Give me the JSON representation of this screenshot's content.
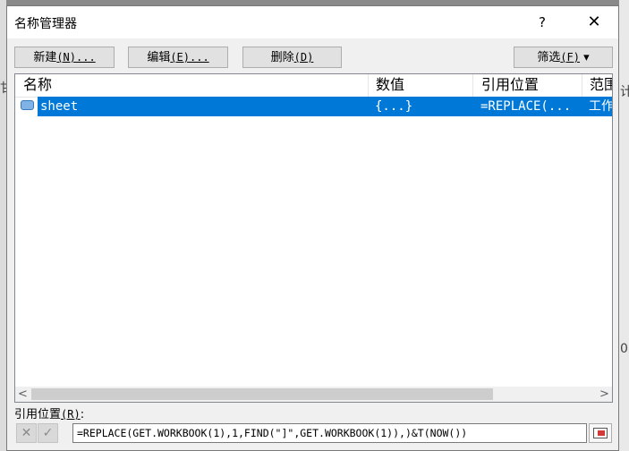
{
  "dialog": {
    "title": "名称管理器",
    "help": "?",
    "close": "✕"
  },
  "toolbar": {
    "new_label": "新建",
    "new_key": "(N)...",
    "edit_label": "编辑",
    "edit_key": "(E)...",
    "delete_label": "删除",
    "delete_key": "(D)",
    "filter_label": "筛选",
    "filter_key": "(F)",
    "filter_arrow": "▾"
  },
  "columns": [
    "名称",
    "数值",
    "引用位置",
    "范围"
  ],
  "rows": [
    {
      "name": "sheet",
      "value": "{...}",
      "refers_to": "=REPLACE(...",
      "scope": "工作簿"
    }
  ],
  "scroll": {
    "left": "<",
    "right": ">"
  },
  "reference": {
    "label": "引用位置",
    "key": "(R)",
    "colon": ":",
    "value": "=REPLACE(GET.WORKBOOK(1),1,FIND(\"]\",GET.WORKBOOK(1)),)&T(NOW())",
    "cancel_glyph": "✕",
    "confirm_glyph": "✓"
  },
  "background": {
    "right_char": "计",
    "right_char2": "0",
    "left_char": "甘"
  }
}
